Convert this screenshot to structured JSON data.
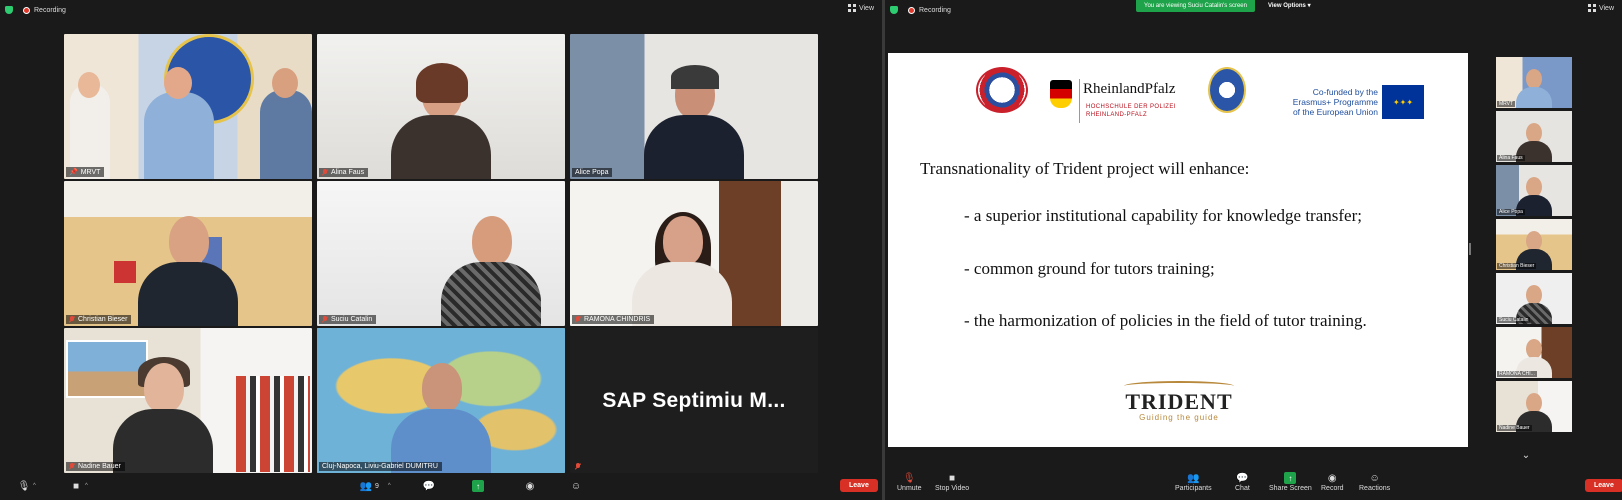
{
  "left": {
    "recording_label": "Recording",
    "view_label": "View",
    "tiles": [
      {
        "name": "MRVT",
        "muted": false,
        "pinned": true,
        "scene": "office-flag"
      },
      {
        "name": "Alina Faus",
        "muted": true,
        "scene": "white-wall"
      },
      {
        "name": "Alice Popa",
        "muted": false,
        "scene": "uniform"
      },
      {
        "name": "Christian Bieser",
        "muted": true,
        "scene": "office-posters"
      },
      {
        "name": "Suciu Catalin",
        "muted": true,
        "scene": "white-wall-man"
      },
      {
        "name": "RAMONA CHINDRIS",
        "muted": true,
        "scene": "door"
      },
      {
        "name": "Nadine Bauer",
        "muted": true,
        "scene": "shelves"
      },
      {
        "name": "Cluj-Napoca, Liviu-Gabriel DUMITRU",
        "muted": false,
        "active": true,
        "scene": "world-map"
      },
      {
        "name": "SAP Septimiu M...",
        "muted": true,
        "noncam": true
      }
    ],
    "toolbar": {
      "participants_count": "9",
      "leave_label": "Leave"
    }
  },
  "right": {
    "recording_label": "Recording",
    "view_label": "View",
    "banner": "You are viewing Suciu Catalin's screen",
    "view_options_label": "View Options",
    "slide": {
      "logo_name": "RheinlandPfalz",
      "logo_sub_1": "HOCHSCHULE DER POLIZEI",
      "logo_sub_2": "RHEINLAND-PFALZ",
      "eu_line_1": "Co-funded by the",
      "eu_line_2": "Erasmus+ Programme",
      "eu_line_3": "of the European Union",
      "heading": "Transnationality of Trident project will enhance:",
      "bullets": [
        "- a superior institutional capability for knowledge transfer;",
        "- common ground for tutors training;",
        "- the harmonization of policies in the field of tutor training."
      ],
      "trident_name": "TRIDENT",
      "trident_tag": "Guiding the guide"
    },
    "side_tiles": [
      {
        "name": "MRVT"
      },
      {
        "name": "Alina Faus"
      },
      {
        "name": "Alice Popa"
      },
      {
        "name": "Christian Bieser"
      },
      {
        "name": "Suciu Catalin",
        "active": true
      },
      {
        "name": "RAMONA CHI..."
      },
      {
        "name": "Nadine Bauer"
      }
    ],
    "toolbar": {
      "unmute_label": "Unmute",
      "stop_video_label": "Stop Video",
      "participants_label": "Participants",
      "participants_count": "9",
      "chat_label": "Chat",
      "share_label": "Share Screen",
      "record_label": "Record",
      "reactions_label": "Reactions",
      "leave_label": "Leave"
    }
  },
  "colors": {
    "active_speaker": "#c6e24a",
    "leave": "#d93025",
    "share": "#1fa34a",
    "eu_blue": "#003399"
  }
}
